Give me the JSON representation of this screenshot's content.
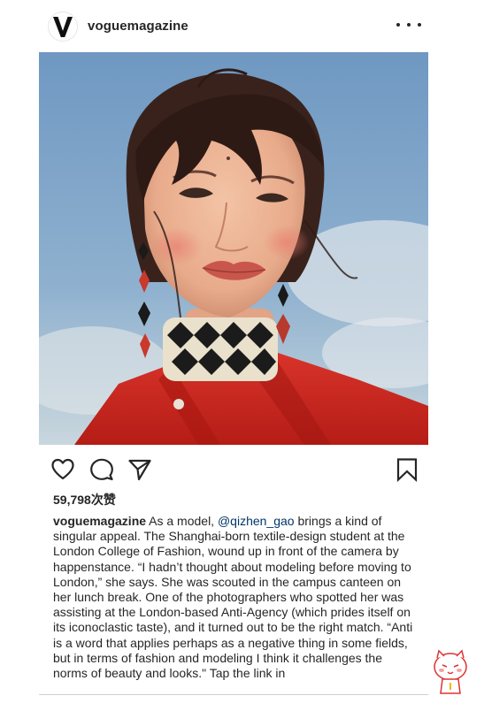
{
  "header": {
    "username": "voguemagazine",
    "avatar_icon": "vogue-v-logo-icon",
    "more_icon": "more-horizontal-icon"
  },
  "photo": {
    "subject": "portrait-photo"
  },
  "actions": {
    "like_icon": "heart-icon",
    "comment_icon": "comment-bubble-icon",
    "share_icon": "paper-plane-icon",
    "save_icon": "bookmark-icon"
  },
  "likes": {
    "text": "59,798次赞"
  },
  "caption": {
    "username": "voguemagazine",
    "part1": " As a model, ",
    "mention": "@qizhen_gao",
    "part2": " brings a kind of singular appeal. The Shanghai-born textile-design student at the London College of Fashion, wound up in front of the camera by happenstance. “I hadn’t thought about modeling before moving to London,” she says. She was scouted in the campus canteen on her lunch break. One of the photographers who spotted her was assisting at the London-based Anti-Agency (which prides itself on its iconoclastic taste), and it turned out to be the right match. “Anti is a word that applies perhaps as a negative thing in some fields, but in terms of fashion and modeling I think it challenges the norms of beauty and looks.\" Tap the link in"
  },
  "colors": {
    "text": "#262626",
    "mention": "#003569",
    "sky": "#7fa6c9",
    "jacket": "#c8231b"
  }
}
